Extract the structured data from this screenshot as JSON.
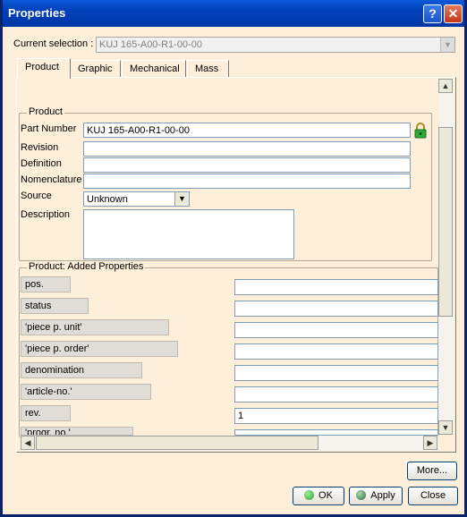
{
  "window": {
    "title": "Properties",
    "help_label": "?",
    "close_label": "✕"
  },
  "current_selection": {
    "label": "Current selection :",
    "value": "KUJ 165-A00-R1-00-00"
  },
  "tabs": [
    {
      "label": "Product",
      "active": true
    },
    {
      "label": "Graphic"
    },
    {
      "label": "Mechanical"
    },
    {
      "label": "Mass"
    }
  ],
  "product_group": {
    "title": "Product",
    "part_number_label": "Part Number",
    "part_number_value": "KUJ 165-A00-R1-00-00",
    "revision_label": "Revision",
    "revision_value": "",
    "definition_label": "Definition",
    "definition_value": "",
    "nomenclature_label": "Nomenclature",
    "nomenclature_value": "",
    "source_label": "Source",
    "source_value": "Unknown",
    "description_label": "Description",
    "description_value": ""
  },
  "added_props": {
    "title": "Product: Added Properties",
    "rows": [
      {
        "label": "pos.",
        "value": ""
      },
      {
        "label": "status",
        "value": ""
      },
      {
        "label": "'piece p. unit'",
        "value": ""
      },
      {
        "label": "'piece p. order'",
        "value": ""
      },
      {
        "label": "denomination",
        "value": ""
      },
      {
        "label": "'article-no.'",
        "value": ""
      },
      {
        "label": "rev.",
        "value": "1"
      },
      {
        "label": "'progr. no.'",
        "value": ""
      }
    ]
  },
  "buttons": {
    "more": "More...",
    "ok": "OK",
    "apply": "Apply",
    "close": "Close"
  },
  "colors": {
    "titlebar": "#0240B8",
    "dialog_bg": "#FDEFD9",
    "ok_dot": "#2E9E2E",
    "apply_dot": "#2E6E3E"
  }
}
